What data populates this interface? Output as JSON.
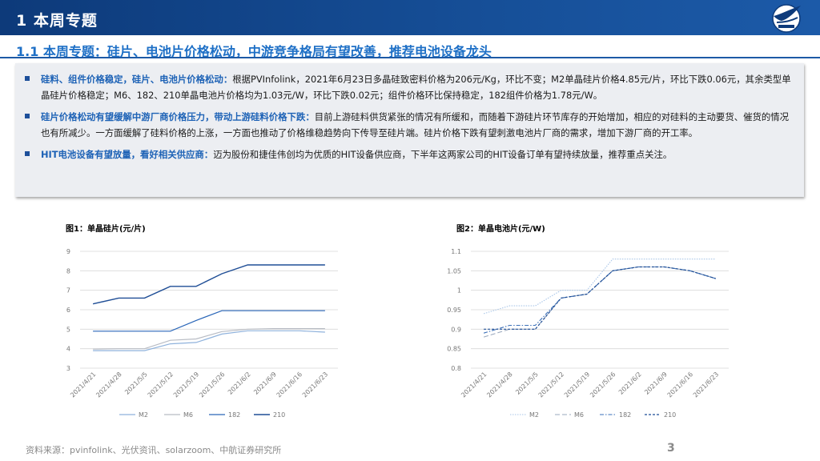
{
  "header": {
    "title": "1 本周专题"
  },
  "subtitle": "1.1 本周专题：硅片、电池片价格松动，中游竞争格局有望改善，推荐电池设备龙头",
  "bullets": [
    {
      "head": "硅料、组件价格稳定，硅片、电池片价格松动：",
      "body": "根据PVInfolink，2021年6月23日多晶硅致密料价格为206元/Kg，环比不变；M2单晶硅片价格4.85元/片，环比下跌0.06元，其余类型单晶硅片价格稳定；M6、182、210单晶电池片价格均为1.03元/W，环比下跌0.02元；组件价格环比保持稳定，182组件价格为1.78元/W。"
    },
    {
      "head": "硅片价格松动有望缓解中游厂商价格压力，带动上游硅料价格下跌：",
      "body": "目前上游硅料供货紧张的情况有所缓和，而随着下游硅片环节库存的开始增加，相应的对硅料的主动要货、催货的情况也有所减少。一方面缓解了硅料价格的上涨，一方面也推动了价格维稳趋势向下传导至硅片端。硅片价格下跌有望刺激电池片厂商的需求，增加下游厂商的开工率。"
    },
    {
      "head": "HIT电池设备有望放量，看好相关供应商：",
      "body": "迈为股份和捷佳伟创均为优质的HIT设备供应商，下半年这两家公司的HIT设备订单有望持续放量，推荐重点关注。"
    }
  ],
  "footer": {
    "source": "资料来源：pvinfolink、光伏资讯、solarzoom、中航证券研究所",
    "page": "3"
  },
  "chart_data": [
    {
      "title": "图1：单晶硅片(元/片)",
      "type": "line",
      "categories": [
        "2021/4/21",
        "2021/4/28",
        "2021/5/5",
        "2021/5/12",
        "2021/5/19",
        "2021/5/26",
        "2021/6/2",
        "2021/6/9",
        "2021/6/16",
        "2021/6/23"
      ],
      "ylim": [
        3,
        9
      ],
      "yticks": [
        "3",
        "4",
        "5",
        "6",
        "7",
        "8",
        "9"
      ],
      "grid": true,
      "legend_position": "bottom",
      "series": [
        {
          "name": "M2",
          "color": "#8fb2dc",
          "dash": "",
          "width": 1.2,
          "values": [
            3.9,
            3.9,
            3.9,
            4.25,
            4.32,
            4.75,
            4.92,
            4.92,
            4.92,
            4.85
          ]
        },
        {
          "name": "M6",
          "color": "#b8bcc4",
          "dash": "",
          "width": 1.2,
          "values": [
            3.98,
            4.0,
            4.0,
            4.43,
            4.5,
            4.88,
            5.0,
            5.03,
            5.03,
            5.03
          ]
        },
        {
          "name": "182",
          "color": "#2a66b8",
          "dash": "",
          "width": 1.2,
          "values": [
            4.9,
            4.9,
            4.9,
            4.9,
            5.45,
            5.95,
            5.95,
            5.95,
            5.95,
            5.95
          ]
        },
        {
          "name": "210",
          "color": "#1f4e96",
          "dash": "",
          "width": 1.4,
          "values": [
            6.3,
            6.6,
            6.6,
            7.2,
            7.2,
            7.85,
            8.3,
            8.3,
            8.3,
            8.3
          ]
        }
      ]
    },
    {
      "title": "图2：单晶电池片(元/W)",
      "type": "line",
      "categories": [
        "2021/4/21",
        "2021/4/28",
        "2021/5/5",
        "2021/5/12",
        "2021/5/19",
        "2021/5/26",
        "2021/6/2",
        "2021/6/9",
        "2021/6/16",
        "2021/6/23"
      ],
      "ylim": [
        0.8,
        1.1
      ],
      "yticks": [
        "0.8",
        "0.85",
        "0.9",
        "0.95",
        "1",
        "1.05",
        "1.1"
      ],
      "grid": true,
      "legend_position": "bottom",
      "series": [
        {
          "name": "M2",
          "color": "#a9c6e8",
          "dash": "1.5,1.5",
          "width": 1.1,
          "values": [
            0.94,
            0.96,
            0.96,
            1.0,
            1.0,
            1.08,
            1.08,
            1.08,
            1.08,
            1.08
          ]
        },
        {
          "name": "M6",
          "color": "#9aa8bd",
          "dash": "6,3",
          "width": 1.1,
          "values": [
            0.88,
            0.9,
            0.9,
            0.98,
            0.99,
            1.05,
            1.06,
            1.06,
            1.05,
            1.03
          ]
        },
        {
          "name": "182",
          "color": "#3a6fb8",
          "dash": "5,2,1.5,2",
          "width": 1.1,
          "values": [
            0.89,
            0.91,
            0.91,
            0.98,
            0.99,
            1.05,
            1.06,
            1.06,
            1.05,
            1.03
          ]
        },
        {
          "name": "210",
          "color": "#1f4e96",
          "dash": "3,2",
          "width": 1.2,
          "values": [
            0.9,
            0.9,
            0.9,
            0.98,
            0.99,
            1.05,
            1.06,
            1.06,
            1.05,
            1.03
          ]
        }
      ]
    }
  ]
}
